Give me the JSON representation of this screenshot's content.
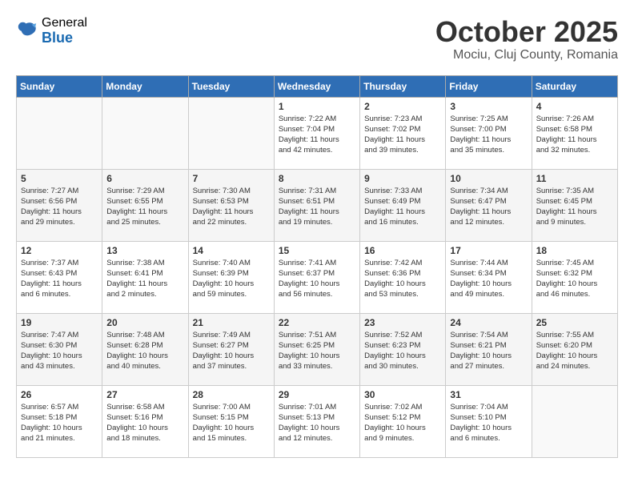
{
  "logo": {
    "general": "General",
    "blue": "Blue"
  },
  "title": {
    "month_year": "October 2025",
    "location": "Mociu, Cluj County, Romania"
  },
  "days_of_week": [
    "Sunday",
    "Monday",
    "Tuesday",
    "Wednesday",
    "Thursday",
    "Friday",
    "Saturday"
  ],
  "weeks": [
    [
      {
        "day": "",
        "info": ""
      },
      {
        "day": "",
        "info": ""
      },
      {
        "day": "",
        "info": ""
      },
      {
        "day": "1",
        "info": "Sunrise: 7:22 AM\nSunset: 7:04 PM\nDaylight: 11 hours\nand 42 minutes."
      },
      {
        "day": "2",
        "info": "Sunrise: 7:23 AM\nSunset: 7:02 PM\nDaylight: 11 hours\nand 39 minutes."
      },
      {
        "day": "3",
        "info": "Sunrise: 7:25 AM\nSunset: 7:00 PM\nDaylight: 11 hours\nand 35 minutes."
      },
      {
        "day": "4",
        "info": "Sunrise: 7:26 AM\nSunset: 6:58 PM\nDaylight: 11 hours\nand 32 minutes."
      }
    ],
    [
      {
        "day": "5",
        "info": "Sunrise: 7:27 AM\nSunset: 6:56 PM\nDaylight: 11 hours\nand 29 minutes."
      },
      {
        "day": "6",
        "info": "Sunrise: 7:29 AM\nSunset: 6:55 PM\nDaylight: 11 hours\nand 25 minutes."
      },
      {
        "day": "7",
        "info": "Sunrise: 7:30 AM\nSunset: 6:53 PM\nDaylight: 11 hours\nand 22 minutes."
      },
      {
        "day": "8",
        "info": "Sunrise: 7:31 AM\nSunset: 6:51 PM\nDaylight: 11 hours\nand 19 minutes."
      },
      {
        "day": "9",
        "info": "Sunrise: 7:33 AM\nSunset: 6:49 PM\nDaylight: 11 hours\nand 16 minutes."
      },
      {
        "day": "10",
        "info": "Sunrise: 7:34 AM\nSunset: 6:47 PM\nDaylight: 11 hours\nand 12 minutes."
      },
      {
        "day": "11",
        "info": "Sunrise: 7:35 AM\nSunset: 6:45 PM\nDaylight: 11 hours\nand 9 minutes."
      }
    ],
    [
      {
        "day": "12",
        "info": "Sunrise: 7:37 AM\nSunset: 6:43 PM\nDaylight: 11 hours\nand 6 minutes."
      },
      {
        "day": "13",
        "info": "Sunrise: 7:38 AM\nSunset: 6:41 PM\nDaylight: 11 hours\nand 2 minutes."
      },
      {
        "day": "14",
        "info": "Sunrise: 7:40 AM\nSunset: 6:39 PM\nDaylight: 10 hours\nand 59 minutes."
      },
      {
        "day": "15",
        "info": "Sunrise: 7:41 AM\nSunset: 6:37 PM\nDaylight: 10 hours\nand 56 minutes."
      },
      {
        "day": "16",
        "info": "Sunrise: 7:42 AM\nSunset: 6:36 PM\nDaylight: 10 hours\nand 53 minutes."
      },
      {
        "day": "17",
        "info": "Sunrise: 7:44 AM\nSunset: 6:34 PM\nDaylight: 10 hours\nand 49 minutes."
      },
      {
        "day": "18",
        "info": "Sunrise: 7:45 AM\nSunset: 6:32 PM\nDaylight: 10 hours\nand 46 minutes."
      }
    ],
    [
      {
        "day": "19",
        "info": "Sunrise: 7:47 AM\nSunset: 6:30 PM\nDaylight: 10 hours\nand 43 minutes."
      },
      {
        "day": "20",
        "info": "Sunrise: 7:48 AM\nSunset: 6:28 PM\nDaylight: 10 hours\nand 40 minutes."
      },
      {
        "day": "21",
        "info": "Sunrise: 7:49 AM\nSunset: 6:27 PM\nDaylight: 10 hours\nand 37 minutes."
      },
      {
        "day": "22",
        "info": "Sunrise: 7:51 AM\nSunset: 6:25 PM\nDaylight: 10 hours\nand 33 minutes."
      },
      {
        "day": "23",
        "info": "Sunrise: 7:52 AM\nSunset: 6:23 PM\nDaylight: 10 hours\nand 30 minutes."
      },
      {
        "day": "24",
        "info": "Sunrise: 7:54 AM\nSunset: 6:21 PM\nDaylight: 10 hours\nand 27 minutes."
      },
      {
        "day": "25",
        "info": "Sunrise: 7:55 AM\nSunset: 6:20 PM\nDaylight: 10 hours\nand 24 minutes."
      }
    ],
    [
      {
        "day": "26",
        "info": "Sunrise: 6:57 AM\nSunset: 5:18 PM\nDaylight: 10 hours\nand 21 minutes."
      },
      {
        "day": "27",
        "info": "Sunrise: 6:58 AM\nSunset: 5:16 PM\nDaylight: 10 hours\nand 18 minutes."
      },
      {
        "day": "28",
        "info": "Sunrise: 7:00 AM\nSunset: 5:15 PM\nDaylight: 10 hours\nand 15 minutes."
      },
      {
        "day": "29",
        "info": "Sunrise: 7:01 AM\nSunset: 5:13 PM\nDaylight: 10 hours\nand 12 minutes."
      },
      {
        "day": "30",
        "info": "Sunrise: 7:02 AM\nSunset: 5:12 PM\nDaylight: 10 hours\nand 9 minutes."
      },
      {
        "day": "31",
        "info": "Sunrise: 7:04 AM\nSunset: 5:10 PM\nDaylight: 10 hours\nand 6 minutes."
      },
      {
        "day": "",
        "info": ""
      }
    ]
  ]
}
